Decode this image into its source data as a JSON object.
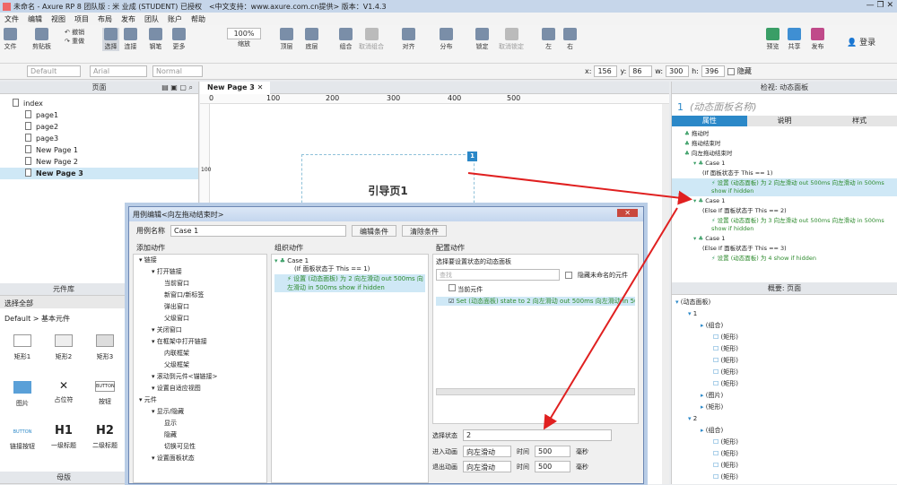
{
  "window": {
    "title": "未命名 - Axure RP 8 团队版 : 米 业成 (STUDENT) 已授权",
    "support": "<中文支持：www.axure.com.cn提供> 版本：V1.4.3"
  },
  "menu": [
    "文件",
    "编辑",
    "视图",
    "项目",
    "布局",
    "发布",
    "团队",
    "账户",
    "帮助"
  ],
  "toolbar": {
    "file": "文件",
    "clipboard": "剪贴板",
    "undo": "撤销",
    "redo": "重做",
    "select": "选择",
    "connect": "连接",
    "pen": "钢笔",
    "more": "更多",
    "zoom": "100%",
    "zoom_label": "缩放",
    "top": "顶层",
    "bottom": "底层",
    "group": "组合",
    "ungroup": "取消组合",
    "align": "对齐",
    "distribute": "分布",
    "lock": "锁定",
    "unlock": "取消锁定",
    "left": "左",
    "right": "右",
    "preview": "预览",
    "share": "共享",
    "publish": "发布",
    "login": "登录"
  },
  "format": {
    "style": "Default",
    "font": "Arial",
    "weight": "Normal",
    "x_label": "x:",
    "x": "156",
    "y_label": "y:",
    "y": "86",
    "w_label": "w:",
    "w": "300",
    "h_label": "h:",
    "h": "396",
    "hidden": "隐藏"
  },
  "pages": {
    "title": "页面",
    "items": [
      "index",
      "page1",
      "page2",
      "page3",
      "New Page 1",
      "New Page 2",
      "New Page 3"
    ]
  },
  "canvas": {
    "tab": "New Page 3",
    "ruler": [
      "0",
      "100",
      "200",
      "300",
      "400",
      "500"
    ],
    "vruler": "100",
    "widget_text": "引导页1",
    "badge": "1"
  },
  "library": {
    "title": "元件库",
    "select": "选择全部",
    "category": "Default > 基本元件",
    "items": [
      "矩形1",
      "矩形2",
      "矩形3",
      "图片",
      "占位符",
      "按钮",
      "链接按钮",
      "一级标题",
      "二级标题"
    ],
    "btn_text": "BUTTON",
    "h1": "H1",
    "h2": "H2",
    "master": "母版"
  },
  "inspector": {
    "title": "检视: 动态面板",
    "index": "1",
    "name": "(动态面板名称)",
    "tabs": [
      "属性",
      "说明",
      "样式"
    ],
    "events": [
      {
        "text": "拖动时",
        "level": 0,
        "hl": false
      },
      {
        "text": "拖动结束时",
        "level": 0,
        "hl": false
      },
      {
        "text": "向左拖动结束时",
        "level": 0,
        "hl": false
      },
      {
        "text": "Case 1",
        "level": 1,
        "hl": false
      },
      {
        "text": "(If 面板状态于 This == 1)",
        "level": 2,
        "hl": false
      },
      {
        "text": "设置 (动态面板) 为 2 向左滑动 out 500ms 向左滑动 in 500ms show if hidden",
        "level": 3,
        "hl": true
      },
      {
        "text": "Case 1",
        "level": 1,
        "hl": false
      },
      {
        "text": "(Else If 面板状态于 This == 2)",
        "level": 2,
        "hl": false
      },
      {
        "text": "设置 (动态面板) 为 3 向左滑动 out 500ms 向左滑动 in 500ms show if hidden",
        "level": 3,
        "hl": false
      },
      {
        "text": "Case 1",
        "level": 1,
        "hl": false
      },
      {
        "text": "(Else If 面板状态于 This == 3)",
        "level": 2,
        "hl": false
      },
      {
        "text": "设置 (动态面板) 为 4 show if hidden",
        "level": 3,
        "hl": false
      }
    ]
  },
  "outline": {
    "title": "概要: 页面",
    "items": [
      {
        "t": "(动态面板)",
        "l": 0
      },
      {
        "t": "1",
        "l": 1
      },
      {
        "t": "(组合)",
        "l": 2
      },
      {
        "t": "(矩形)",
        "l": 3
      },
      {
        "t": "(矩形)",
        "l": 3
      },
      {
        "t": "(矩形)",
        "l": 3
      },
      {
        "t": "(矩形)",
        "l": 3
      },
      {
        "t": "(矩形)",
        "l": 3
      },
      {
        "t": "(图片)",
        "l": 2
      },
      {
        "t": "(矩形)",
        "l": 2
      },
      {
        "t": "2",
        "l": 1
      },
      {
        "t": "(组合)",
        "l": 2
      },
      {
        "t": "(矩形)",
        "l": 3
      },
      {
        "t": "(矩形)",
        "l": 3
      },
      {
        "t": "(矩形)",
        "l": 3
      },
      {
        "t": "(矩形)",
        "l": 3
      }
    ]
  },
  "dialog": {
    "title": "用例编辑<向左拖动结束时>",
    "case_label": "用例名称",
    "case_name": "Case 1",
    "edit_cond": "编辑条件",
    "clear_cond": "清除条件",
    "add_action": "添加动作",
    "org_action": "组织动作",
    "config_action": "配置动作",
    "actions": [
      {
        "t": "链接",
        "l": 0
      },
      {
        "t": "打开链接",
        "l": 1
      },
      {
        "t": "当前窗口",
        "l": 2
      },
      {
        "t": "新窗口/新标签",
        "l": 2
      },
      {
        "t": "弹出窗口",
        "l": 2
      },
      {
        "t": "父级窗口",
        "l": 2
      },
      {
        "t": "关闭窗口",
        "l": 1
      },
      {
        "t": "在框架中打开链接",
        "l": 1
      },
      {
        "t": "内联框架",
        "l": 2
      },
      {
        "t": "父级框架",
        "l": 2
      },
      {
        "t": "滚动到元件<锚链接>",
        "l": 1
      },
      {
        "t": "设置自适应视图",
        "l": 1
      },
      {
        "t": "元件",
        "l": 0
      },
      {
        "t": "显示/隐藏",
        "l": 1
      },
      {
        "t": "显示",
        "l": 2
      },
      {
        "t": "隐藏",
        "l": 2
      },
      {
        "t": "切换可见性",
        "l": 2
      },
      {
        "t": "设置面板状态",
        "l": 1
      }
    ],
    "org_case": "Case 1",
    "org_cond": "(If 面板状态于 This == 1)",
    "org_action_text": "设置 (动态面板) 为 2 向左滑动 out 500ms 向左滑动 in 500ms show if hidden",
    "select_panel": "选择要设置状态的动态面板",
    "search": "查找",
    "hide_unnamed": "隐藏未命名的元件",
    "current": "当前元件",
    "set_state": "Set (动态面板) state to 2 向左滑动 out 500ms 向左滑动 in 500",
    "state_label": "选择状态",
    "state": "2",
    "enter_anim": "进入动画",
    "exit_anim": "退出动画",
    "anim": "向左滑动",
    "time": "时间",
    "ms": "500",
    "unit": "毫秒"
  }
}
